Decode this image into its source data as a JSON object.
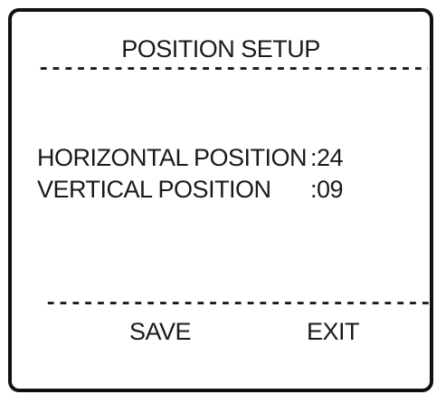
{
  "menu": {
    "title": "POSITION SETUP",
    "separator_top": "------------------------------------",
    "separator_bottom": "------------------------------------",
    "horizontal": {
      "label": "HORIZONTAL POSITION",
      "value": ":24"
    },
    "vertical": {
      "label": "VERTICAL POSITION",
      "value": ":09"
    },
    "save_label": "SAVE",
    "exit_label": "EXIT"
  }
}
